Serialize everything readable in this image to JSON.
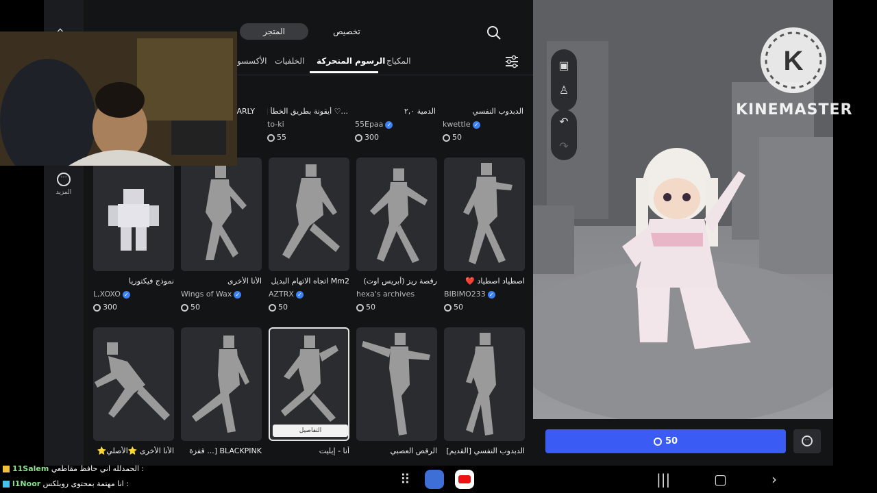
{
  "top_tabs": [
    {
      "label": "المتجر",
      "active": true
    },
    {
      "label": "تخصيص",
      "active": false
    }
  ],
  "categories": [
    {
      "label": "المكياج"
    },
    {
      "label": "الرسوم المتحركة",
      "active": true
    },
    {
      "label": "الخلفيات"
    },
    {
      "label": "الأكسسو"
    }
  ],
  "sidebar": {
    "more_label": "المزيد"
  },
  "partial_row": [
    {
      "name": "ARLY",
      "creator": "",
      "price": ""
    },
    {
      "name": "...♡ أيقونة بطريق الخطأ [",
      "creator": "to-ki",
      "price": "55"
    },
    {
      "name": "الدمية ٢,٠",
      "creator": "55Epaa",
      "price": "300"
    },
    {
      "name": "الدبدوب النفسي",
      "creator": "kwettle",
      "price": "50"
    }
  ],
  "row1": [
    {
      "name": "نموذج فيكتوريا",
      "creator": "L,XOXO",
      "price": "300"
    },
    {
      "name": "الأنا الأخرى",
      "creator": "Wings of Wax",
      "price": "50"
    },
    {
      "name": "Mm2 اتجاه الاتهام البديل",
      "creator": "AZTRX",
      "price": "50"
    },
    {
      "name": "رقصة ريز (أبريس اوت)",
      "creator": "hexa's archives",
      "price": "50"
    },
    {
      "name": "اصطياد اصطياد ❤️",
      "creator": "BIBIMO233",
      "price": "50"
    }
  ],
  "row2": [
    {
      "name": "الأنا الأخرى ⭐الأصلي⭐"
    },
    {
      "name": "BLACKPINK [... قفزة"
    },
    {
      "name": "أنا - إيليت",
      "details": "التفاصيل"
    },
    {
      "name": "الرقص العصبي"
    },
    {
      "name": "الدبدوب النفسي [القديم]"
    }
  ],
  "buy": {
    "price": "50"
  },
  "watermark": "KINEMASTER",
  "chat": [
    {
      "user": "11Salem",
      "text": "الحمدلله اني حافظ مقاطعي :"
    },
    {
      "user": "l1Noor",
      "text": "انا مهتمة بمحتوى روبلكس :"
    }
  ],
  "colors": {
    "accent": "#3b5bf5",
    "verified": "#3b82f6",
    "panel": "#131416",
    "card": "#2b2c2f"
  }
}
